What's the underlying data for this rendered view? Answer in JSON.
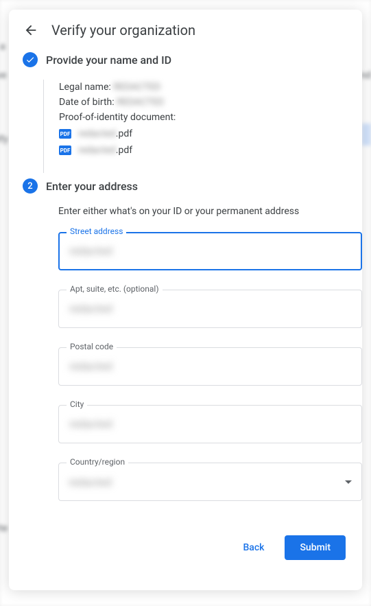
{
  "header": {
    "title": "Verify your organization"
  },
  "step1": {
    "title": "Provide your name and ID",
    "legal_name_label": "Legal name:",
    "legal_name_value": "REDACTED",
    "dob_label": "Date of birth:",
    "dob_value": "REDACTED",
    "doc_label": "Proof-of-identity document:",
    "files": [
      {
        "name_redacted": "redacted",
        "ext": ".pdf"
      },
      {
        "name_redacted": "redacted",
        "ext": ".pdf"
      }
    ],
    "pdf_icon_label": "PDF"
  },
  "step2": {
    "number": "2",
    "title": "Enter your address",
    "helper": "Enter either what's on your ID or your permanent address",
    "fields": {
      "street": {
        "label": "Street address",
        "value": "redacted"
      },
      "apt": {
        "label": "Apt, suite, etc. (optional)",
        "value": "redacted"
      },
      "postal": {
        "label": "Postal code",
        "value": "redacted"
      },
      "city": {
        "label": "City",
        "value": "redacted"
      },
      "country": {
        "label": "Country/region",
        "value": "redacted"
      }
    }
  },
  "footer": {
    "back": "Back",
    "submit": "Submit"
  }
}
